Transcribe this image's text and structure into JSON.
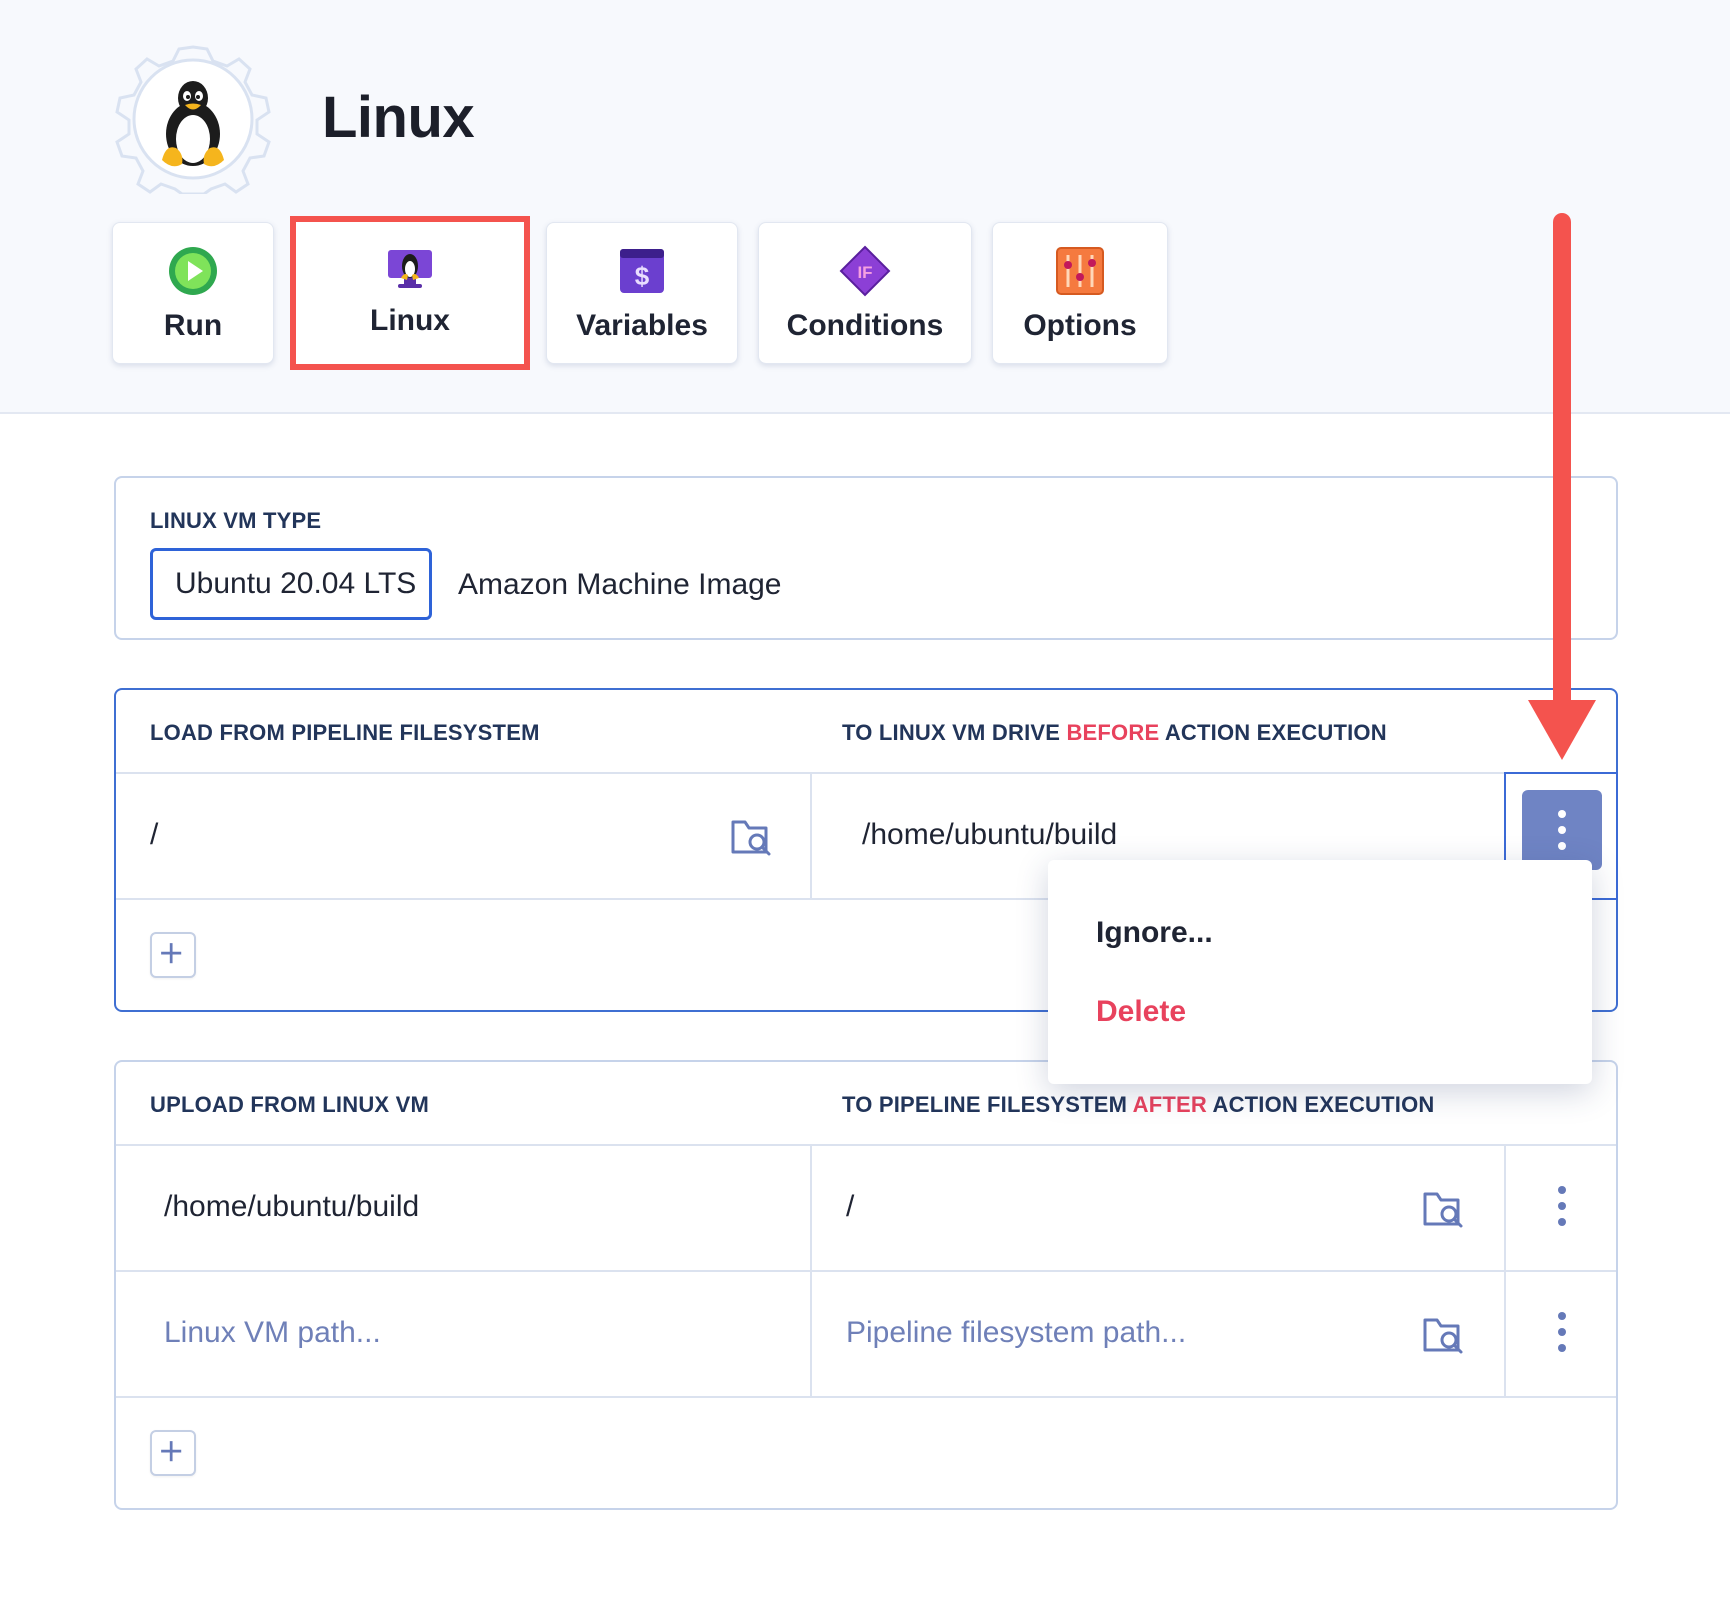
{
  "header": {
    "title": "Linux",
    "logo_icon": "linux-penguin-gear-icon"
  },
  "tabs": [
    {
      "label": "Run",
      "icon": "play-icon",
      "active": false
    },
    {
      "label": "Linux",
      "icon": "linux-monitor-icon",
      "active": true
    },
    {
      "label": "Variables",
      "icon": "variables-dollar-icon",
      "active": false
    },
    {
      "label": "Conditions",
      "icon": "conditions-if-icon",
      "active": false
    },
    {
      "label": "Options",
      "icon": "options-sliders-icon",
      "active": false
    }
  ],
  "vm_type": {
    "label": "LINUX VM TYPE",
    "selected": "Ubuntu 20.04 LTS",
    "other_option": "Amazon Machine Image"
  },
  "load_section": {
    "left_header": "LOAD FROM PIPELINE FILESYSTEM",
    "right_header_prefix": "TO LINUX VM DRIVE ",
    "right_header_highlight": "BEFORE",
    "right_header_suffix": " ACTION EXECUTION",
    "rows": [
      {
        "source": "/",
        "destination": "/home/ubuntu/build"
      }
    ]
  },
  "upload_section": {
    "left_header": "UPLOAD FROM LINUX VM",
    "right_header_prefix": "TO PIPELINE FILESYSTEM ",
    "right_header_highlight": "AFTER",
    "right_header_suffix": " ACTION EXECUTION",
    "rows": [
      {
        "source": "/home/ubuntu/build",
        "destination": "/"
      }
    ],
    "placeholders": {
      "source": "Linux VM path...",
      "destination": "Pipeline filesystem path..."
    }
  },
  "context_menu": {
    "items": [
      {
        "label": "Ignore...",
        "color": "#1f2433"
      },
      {
        "label": "Delete",
        "color": "#e8425d"
      }
    ]
  },
  "colors": {
    "accent": "#2e63d8",
    "highlight": "#e8425d",
    "annotation": "#f4534e",
    "kebab_active": "#6f84c4",
    "placeholder": "#6f80b8"
  }
}
